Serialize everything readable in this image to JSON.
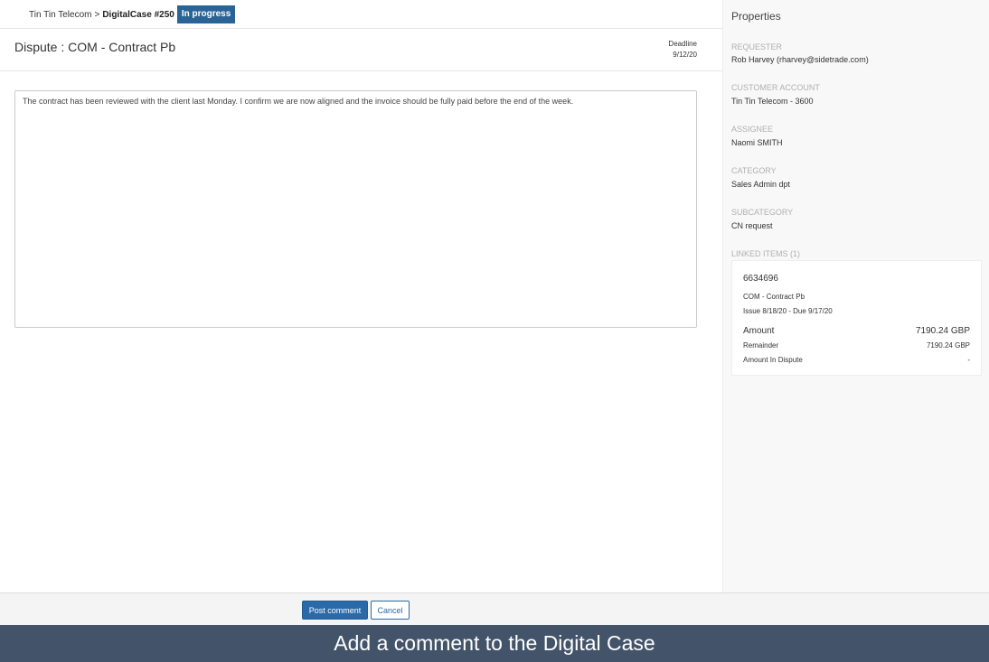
{
  "breadcrumb": {
    "account": "Tin Tin Telecom",
    "separator": ">",
    "case": "DigitalCase #250",
    "status": "In progress"
  },
  "case": {
    "title": "Dispute : COM - Contract Pb",
    "deadline_label": "Deadline",
    "deadline_value": "9/12/20"
  },
  "comment": {
    "text": "The contract has been reviewed with the client last Monday. I confirm we are now aligned and the invoice should be fully paid before the end of the week."
  },
  "properties": {
    "title": "Properties",
    "requester_label": "REQUESTER",
    "requester_value": "Rob Harvey (rharvey@sidetrade.com)",
    "customer_label": "CUSTOMER ACCOUNT",
    "customer_value": "Tin Tin Telecom - 3600",
    "assignee_label": "ASSIGNEE",
    "assignee_value": "Naomi SMITH",
    "category_label": "CATEGORY",
    "category_value": "Sales Admin dpt",
    "subcategory_label": "SUBCATEGORY",
    "subcategory_value": "CN request",
    "linked_label": "LINKED ITEMS (1)"
  },
  "linked_item": {
    "id": "6634696",
    "description": "COM - Contract Pb",
    "dates": "Issue 8/18/20 - Due 9/17/20",
    "amount_label": "Amount",
    "amount_value": "7190.24 GBP",
    "remainder_label": "Remainder",
    "remainder_value": "7190.24 GBP",
    "dispute_label": "Amount In Dispute",
    "dispute_value": "-"
  },
  "actions": {
    "post_label": "Post comment",
    "cancel_label": "Cancel"
  },
  "caption": "Add a comment to the Digital Case",
  "colors": {
    "status_badge": "#2a6496",
    "primary_button": "#2a6aa8",
    "caption_bar": "#43546a"
  }
}
